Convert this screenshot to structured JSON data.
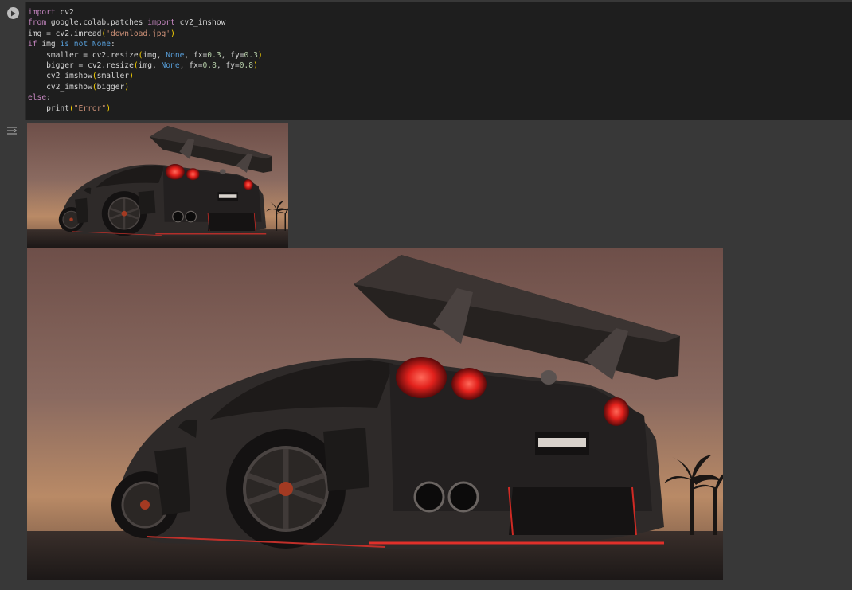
{
  "cell": {
    "code_lines": [
      [
        {
          "t": "import",
          "c": "kw"
        },
        {
          "t": " cv2",
          "c": ""
        }
      ],
      [
        {
          "t": "from",
          "c": "kw"
        },
        {
          "t": " google.colab.patches ",
          "c": ""
        },
        {
          "t": "import",
          "c": "kw"
        },
        {
          "t": " cv2_imshow",
          "c": ""
        }
      ],
      [
        {
          "t": "img = cv2.imread",
          "c": ""
        },
        {
          "t": "(",
          "c": "paren"
        },
        {
          "t": "'download.jpg'",
          "c": "str"
        },
        {
          "t": ")",
          "c": "paren"
        }
      ],
      [
        {
          "t": "if",
          "c": "kw"
        },
        {
          "t": " img ",
          "c": ""
        },
        {
          "t": "is",
          "c": "blue"
        },
        {
          "t": " ",
          "c": ""
        },
        {
          "t": "not",
          "c": "blue"
        },
        {
          "t": " ",
          "c": ""
        },
        {
          "t": "None",
          "c": "blue"
        },
        {
          "t": ":",
          "c": ""
        }
      ],
      [
        {
          "t": "    smaller = cv2.resize",
          "c": ""
        },
        {
          "t": "(",
          "c": "paren"
        },
        {
          "t": "img, ",
          "c": ""
        },
        {
          "t": "None",
          "c": "blue"
        },
        {
          "t": ", fx=",
          "c": ""
        },
        {
          "t": "0.3",
          "c": "num"
        },
        {
          "t": ", fy=",
          "c": ""
        },
        {
          "t": "0.3",
          "c": "num"
        },
        {
          "t": ")",
          "c": "paren"
        }
      ],
      [
        {
          "t": "    bigger = cv2.resize",
          "c": ""
        },
        {
          "t": "(",
          "c": "paren"
        },
        {
          "t": "img, ",
          "c": ""
        },
        {
          "t": "None",
          "c": "blue"
        },
        {
          "t": ", fx=",
          "c": ""
        },
        {
          "t": "0.8",
          "c": "num"
        },
        {
          "t": ", fy=",
          "c": ""
        },
        {
          "t": "0.8",
          "c": "num"
        },
        {
          "t": ")",
          "c": "paren"
        }
      ],
      [
        {
          "t": "    cv2_imshow",
          "c": ""
        },
        {
          "t": "(",
          "c": "paren"
        },
        {
          "t": "smaller",
          "c": ""
        },
        {
          "t": ")",
          "c": "paren"
        }
      ],
      [
        {
          "t": "    cv2_imshow",
          "c": ""
        },
        {
          "t": "(",
          "c": "paren"
        },
        {
          "t": "bigger",
          "c": ""
        },
        {
          "t": ")",
          "c": "paren"
        }
      ],
      [
        {
          "t": "else",
          "c": "kw"
        },
        {
          "t": ":",
          "c": ""
        }
      ],
      [
        {
          "t": "    print",
          "c": ""
        },
        {
          "t": "(",
          "c": "paren"
        },
        {
          "t": "\"Error\"",
          "c": "str"
        },
        {
          "t": ")",
          "c": "paren"
        }
      ]
    ]
  },
  "output": {
    "images": [
      {
        "name": "output-image-smaller",
        "icon": "car-photo"
      },
      {
        "name": "output-image-bigger",
        "icon": "car-photo"
      }
    ]
  },
  "icons": {
    "run": "play-circle-icon",
    "output_toggle": "output-toggle-icon"
  },
  "colors": {
    "page_bg": "#383838",
    "editor_bg": "#1e1e1e",
    "keyword": "#c586c0",
    "builtin": "#569cd6",
    "string": "#ce9178",
    "number": "#b5cea8"
  }
}
